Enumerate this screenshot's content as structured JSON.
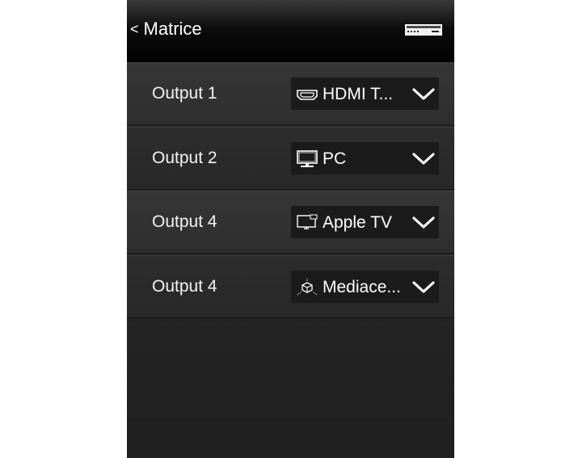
{
  "nav": {
    "back_chevron": "<",
    "back_label": "Matrice",
    "device_icon": "av-receiver-icon"
  },
  "rows": [
    {
      "output_label": "Output 1",
      "source_label": "HDMI T...",
      "source_icon": "hdmi-port-icon"
    },
    {
      "output_label": "Output 2",
      "source_label": "PC",
      "source_icon": "desktop-computer-icon"
    },
    {
      "output_label": "Output 4",
      "source_label": "Apple TV",
      "source_icon": "apple-tv-icon"
    },
    {
      "output_label": "Output 4",
      "source_label": "Mediace...",
      "source_icon": "media-center-cube-icon"
    }
  ],
  "colors": {
    "background": "#262626",
    "text": "#ffffff",
    "dropdown": "#1b1b1b"
  }
}
